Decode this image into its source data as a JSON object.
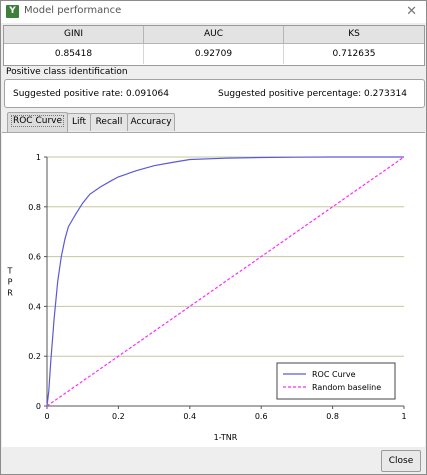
{
  "window": {
    "title": "Model performance",
    "app_icon_letter": "Y"
  },
  "metrics": {
    "headers": [
      "GINI",
      "AUC",
      "KS"
    ],
    "values": [
      "0.85418",
      "0.92709",
      "0.712635"
    ]
  },
  "positive": {
    "section_label": "Positive class identification",
    "rate_text": "Suggested positive rate: 0.091064",
    "percentage_text": "Suggested positive percentage: 0.273314"
  },
  "tabs": [
    {
      "label": "ROC Curve",
      "active": true
    },
    {
      "label": "Lift",
      "active": false
    },
    {
      "label": "Recall",
      "active": false
    },
    {
      "label": "Accuracy",
      "active": false
    }
  ],
  "chart_data": {
    "type": "line",
    "xlabel": "1-TNR",
    "ylabel": "T\nP\nR",
    "xlim": [
      0,
      1
    ],
    "ylim": [
      0,
      1
    ],
    "xticks": [
      "0",
      "0.2",
      "0.4",
      "0.6",
      "0.8",
      "1"
    ],
    "yticks": [
      "0",
      "0.2",
      "0.4",
      "0.6",
      "0.8",
      "1"
    ],
    "grid": "horizontal",
    "legend_position": "bottom-right",
    "series": [
      {
        "name": "ROC Curve",
        "color": "#5a5ad6",
        "style": "solid",
        "x": [
          0,
          0.005,
          0.01,
          0.02,
          0.03,
          0.04,
          0.05,
          0.06,
          0.07,
          0.08,
          0.1,
          0.12,
          0.15,
          0.18,
          0.2,
          0.25,
          0.3,
          0.35,
          0.4,
          0.5,
          0.6,
          0.7,
          0.8,
          0.9,
          1.0
        ],
        "y": [
          0,
          0.06,
          0.17,
          0.35,
          0.5,
          0.6,
          0.67,
          0.72,
          0.745,
          0.77,
          0.815,
          0.85,
          0.88,
          0.905,
          0.92,
          0.945,
          0.965,
          0.978,
          0.99,
          0.995,
          0.998,
          0.999,
          1.0,
          1.0,
          1.0
        ]
      },
      {
        "name": "Random baseline",
        "color": "#ff2bff",
        "style": "dashed",
        "x": [
          0,
          1
        ],
        "y": [
          0,
          1
        ]
      }
    ]
  },
  "buttons": {
    "close_label": "Close"
  }
}
